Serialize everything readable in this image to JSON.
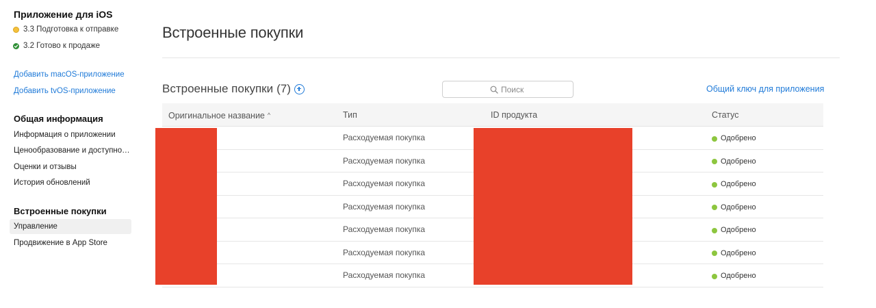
{
  "sidebar": {
    "app_title": "Приложение для iOS",
    "versions": [
      {
        "label": "3.3 Подготовка к отправке",
        "status": "prepare",
        "color": "#f5c13d"
      },
      {
        "label": "3.2 Готово к продаже",
        "status": "ready",
        "color": "#2f8f36"
      }
    ],
    "add_links": [
      {
        "label": "Добавить macOS-приложение"
      },
      {
        "label": "Добавить tvOS-приложение"
      }
    ],
    "general": {
      "heading": "Общая информация",
      "items": [
        {
          "label": "Информация о приложении"
        },
        {
          "label": "Ценообразование и доступность"
        },
        {
          "label": "Оценки и отзывы"
        },
        {
          "label": "История обновлений"
        }
      ]
    },
    "iap": {
      "heading": "Встроенные покупки",
      "items": [
        {
          "label": "Управление",
          "active": true
        },
        {
          "label": "Продвижение в App Store",
          "active": false
        }
      ]
    }
  },
  "main": {
    "page_title": "Встроенные покупки",
    "section_title": "Встроенные покупки",
    "count": "(7)",
    "search": {
      "placeholder": "Поиск",
      "value": ""
    },
    "shared_key_link": "Общий ключ для приложения",
    "table": {
      "columns": [
        {
          "label": "Оригинальное название",
          "sorted": "asc"
        },
        {
          "label": "Тип"
        },
        {
          "label": "ID продукта"
        },
        {
          "label": "Статус"
        }
      ],
      "rows": [
        {
          "name": "",
          "type": "Расходуемая покупка",
          "product_id": "",
          "status": "Одобрено"
        },
        {
          "name": "",
          "type": "Расходуемая покупка",
          "product_id": "",
          "status": "Одобрено"
        },
        {
          "name": "",
          "type": "Расходуемая покупка",
          "product_id": "",
          "status": "Одобрено"
        },
        {
          "name": "",
          "type": "Расходуемая покупка",
          "product_id": "",
          "status": "Одобрено"
        },
        {
          "name": "",
          "type": "Расходуемая покупка",
          "product_id": "",
          "status": "Одобрено"
        },
        {
          "name": "",
          "type": "Расходуемая покупка",
          "product_id": "",
          "status": "Одобрено"
        },
        {
          "name": "",
          "type": "Расходуемая покупка",
          "product_id": "",
          "status": "Одобрено"
        }
      ]
    }
  },
  "colors": {
    "link": "#1f7ad8",
    "status_approved": "#8dc63f",
    "redaction": "#e8412a"
  }
}
